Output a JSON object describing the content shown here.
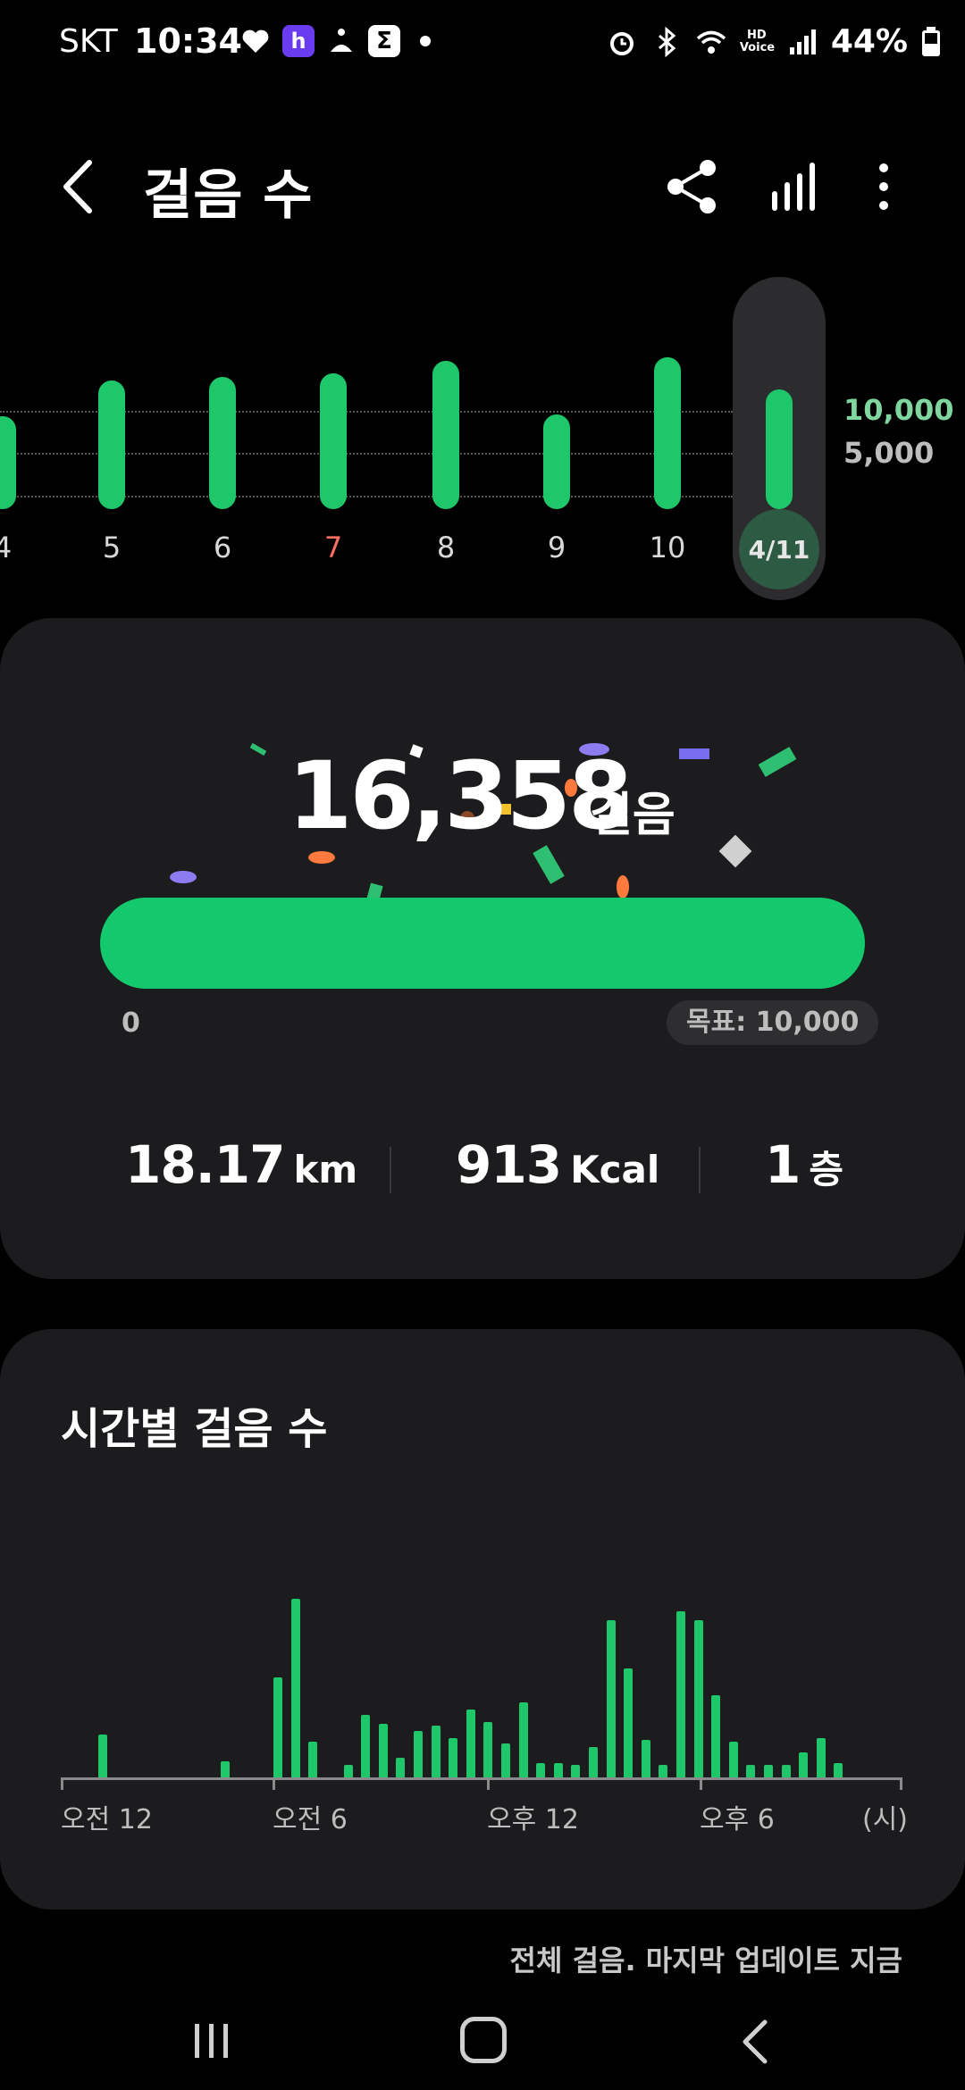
{
  "status_bar": {
    "carrier": "SKT",
    "time": "10:34",
    "battery": "44%",
    "hd_voice": "HD Voice"
  },
  "header": {
    "title": "걸음 수"
  },
  "day_chart": {
    "selected_label": "4/11",
    "y_labels": {
      "goal": "10,000",
      "mid": "5,000"
    },
    "days": [
      {
        "label": "4",
        "ratio": 0.52,
        "sunday": false
      },
      {
        "label": "5",
        "ratio": 0.72,
        "sunday": false
      },
      {
        "label": "6",
        "ratio": 0.74,
        "sunday": false
      },
      {
        "label": "7",
        "ratio": 0.76,
        "sunday": true
      },
      {
        "label": "8",
        "ratio": 0.83,
        "sunday": false
      },
      {
        "label": "9",
        "ratio": 0.53,
        "sunday": false
      },
      {
        "label": "10",
        "ratio": 0.85,
        "sunday": false
      },
      {
        "label": "4/11",
        "ratio": 0.67,
        "sunday": false,
        "selected": true
      }
    ]
  },
  "summary": {
    "steps": "16,358",
    "steps_unit": "걸음",
    "progress_zero": "0",
    "goal_label": "목표: 10,000",
    "distance_value": "18.17",
    "distance_unit": "km",
    "calories_value": "913",
    "calories_unit": "Kcal",
    "floors_value": "1",
    "floors_unit": "층"
  },
  "hourly": {
    "title": "시간별 걸음 수",
    "x_labels": [
      "오전 12",
      "오전 6",
      "오후 12",
      "오후 6",
      "(시)"
    ],
    "bars": [
      {
        "slot": 2,
        "h": 48
      },
      {
        "slot": 9,
        "h": 18
      },
      {
        "slot": 12,
        "h": 112
      },
      {
        "slot": 13,
        "h": 200
      },
      {
        "slot": 14,
        "h": 40
      },
      {
        "slot": 16,
        "h": 14
      },
      {
        "slot": 17,
        "h": 70
      },
      {
        "slot": 18,
        "h": 60
      },
      {
        "slot": 19,
        "h": 22
      },
      {
        "slot": 20,
        "h": 52
      },
      {
        "slot": 21,
        "h": 58
      },
      {
        "slot": 22,
        "h": 44
      },
      {
        "slot": 23,
        "h": 76
      },
      {
        "slot": 24,
        "h": 62
      },
      {
        "slot": 25,
        "h": 38
      },
      {
        "slot": 26,
        "h": 84
      },
      {
        "slot": 27,
        "h": 16
      },
      {
        "slot": 28,
        "h": 16
      },
      {
        "slot": 29,
        "h": 14
      },
      {
        "slot": 30,
        "h": 34
      },
      {
        "slot": 31,
        "h": 176
      },
      {
        "slot": 32,
        "h": 122
      },
      {
        "slot": 33,
        "h": 42
      },
      {
        "slot": 34,
        "h": 14
      },
      {
        "slot": 35,
        "h": 186
      },
      {
        "slot": 36,
        "h": 176
      },
      {
        "slot": 37,
        "h": 92
      },
      {
        "slot": 38,
        "h": 40
      },
      {
        "slot": 39,
        "h": 14
      },
      {
        "slot": 40,
        "h": 14
      },
      {
        "slot": 41,
        "h": 14
      },
      {
        "slot": 42,
        "h": 28
      },
      {
        "slot": 43,
        "h": 44
      },
      {
        "slot": 44,
        "h": 16
      }
    ]
  },
  "footer": {
    "text": "전체 걸음. 마지막 업데이트 지금"
  },
  "colors": {
    "accent_green": "#1ec76a",
    "card_bg": "#1c1c1e",
    "sunday_red": "#ff6e66"
  }
}
